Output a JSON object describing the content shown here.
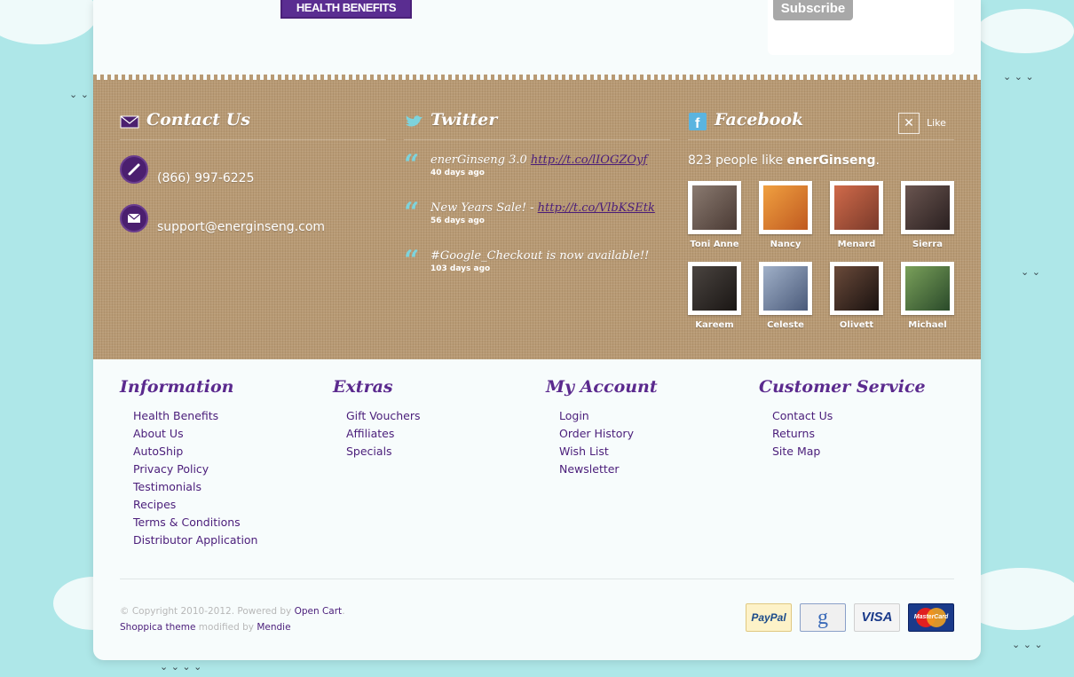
{
  "top": {
    "health_benefits_button": "HEALTH BENEFITS",
    "subscribe_button": "Subscribe"
  },
  "contact": {
    "title": "Contact Us",
    "phone": "(866) 997-6225",
    "email": "support@energinseng.com"
  },
  "twitter": {
    "title": "Twitter",
    "tweets": [
      {
        "text": "enerGinseng 3.0 ",
        "link": "http://t.co/lIOGZOyf",
        "time": "40 days ago"
      },
      {
        "text": "New Years Sale! - ",
        "link": "http://t.co/VlbKSEtk",
        "time": "56 days ago"
      },
      {
        "text": "#Google_Checkout is now available!!",
        "link": "",
        "time": "103 days ago"
      }
    ]
  },
  "facebook": {
    "title": "Facebook",
    "like_label": "Like",
    "count_text": "823 people like ",
    "page_name": "enerGinseng",
    "count_suffix": ".",
    "fans": [
      {
        "name": "Toni Anne",
        "color": "#6a5a52"
      },
      {
        "name": "Nancy",
        "color": "#d9842a"
      },
      {
        "name": "Menard",
        "color": "#b04a3a"
      },
      {
        "name": "Sierra",
        "color": "#4a3a36"
      },
      {
        "name": "Kareem",
        "color": "#2b2622"
      },
      {
        "name": "Celeste",
        "color": "#7a86a0"
      },
      {
        "name": "Olivett",
        "color": "#3a2a22"
      },
      {
        "name": "Michael",
        "color": "#4a7a3a"
      }
    ]
  },
  "footer": {
    "information": {
      "title": "Information",
      "links": [
        "Health Benefits",
        "About Us",
        "AutoShip",
        "Privacy Policy",
        "Testimonials",
        "Recipes",
        "Terms & Conditions",
        "Distributor Application"
      ]
    },
    "extras": {
      "title": "Extras",
      "links": [
        "Gift Vouchers",
        "Affiliates",
        "Specials"
      ]
    },
    "account": {
      "title": "My Account",
      "links": [
        "Login",
        "Order History",
        "Wish List",
        "Newsletter"
      ]
    },
    "service": {
      "title": "Customer Service",
      "links": [
        "Contact Us",
        "Returns",
        "Site Map"
      ]
    },
    "copyright": "© Copyright 2010-2012. Powered by ",
    "opencart_link": "Open Cart",
    "copyright_end": ".",
    "theme_link": "Shoppica theme",
    "modified_by": " modified by ",
    "author_link": "Mendie",
    "payment": {
      "paypal": "PayPal",
      "google": "g",
      "visa": "VISA",
      "mastercard": "MasterCard"
    }
  },
  "colors": {
    "sky": "#aee7e8",
    "burlap": "#b89a74",
    "purple": "#5b2a8e",
    "link": "#4a1d7a"
  }
}
